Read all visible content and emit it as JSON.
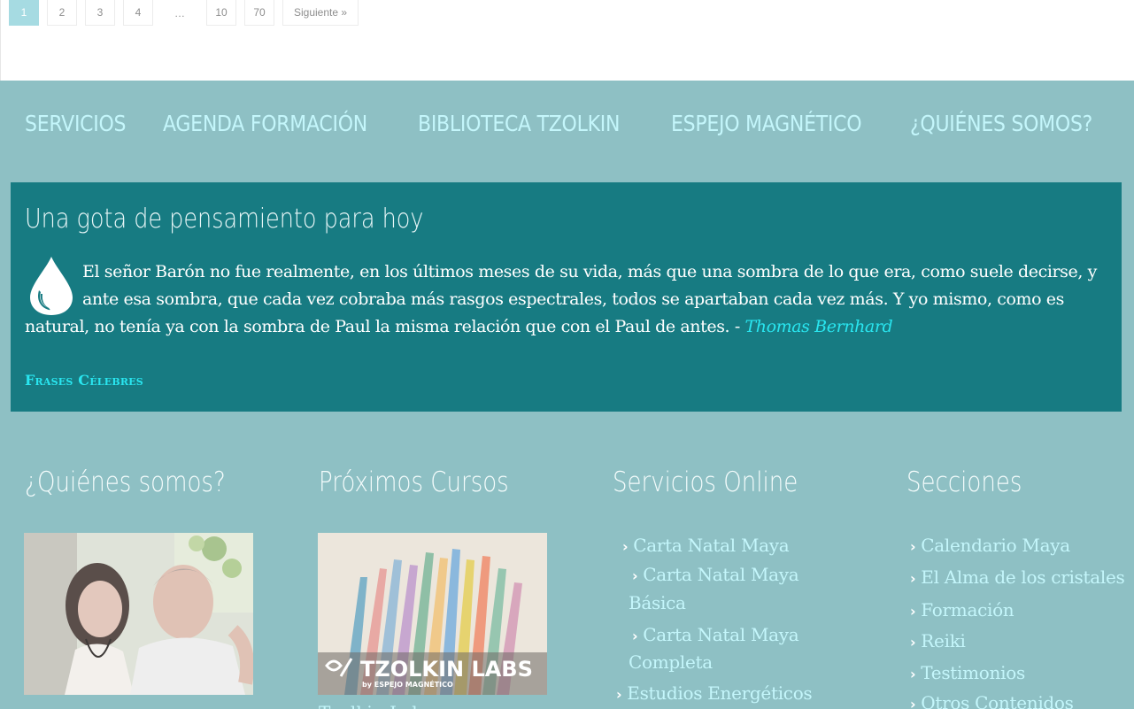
{
  "pagination": {
    "pages": [
      "1",
      "2",
      "3",
      "4",
      "…",
      "10",
      "70"
    ],
    "active_index": 0,
    "next_label": "Siguiente »"
  },
  "nav": {
    "items": [
      "SERVICIOS",
      "AGENDA FORMACIÓN",
      "BIBLIOTECA TZOLKIN",
      "ESPEJO MAGNÉTICO",
      "¿QUIÉNES SOMOS?"
    ]
  },
  "quote_widget": {
    "title": "Una gota de pensamiento para hoy",
    "text": "El señor Barón no fue realmente, en los últimos meses de su vida, más que una sombra de lo que era, como suele decirse, y ante esa sombra, que cada vez cobraba más rasgos espectrales, todos se apartaban cada vez más. Y yo mismo, como es natural, no tenía ya con la sombra de Paul la misma relación que con el Paul de antes. -",
    "author": "Thomas Bernhard",
    "source_link": "Frases Célebres",
    "icon": "water-drop-icon"
  },
  "footer": {
    "about": {
      "title": "¿Quiénes somos?"
    },
    "courses": {
      "title": "Próximos Cursos",
      "banner_text": "TZOLKIN LABS",
      "banner_subtext": "by ESPEJO MAGNÉTICO",
      "link_partial": "Tzolkin Lab"
    },
    "online": {
      "title": "Servicios Online",
      "items": [
        "Carta Natal Maya",
        "Carta Natal Maya",
        "Básica",
        "Carta Natal Maya",
        "Completa",
        "Estudios Energéticos"
      ]
    },
    "sections": {
      "title": "Secciones",
      "items": [
        "Calendario Maya",
        "El Alma de los cristales",
        "Formación",
        "Reiki",
        "Testimonios",
        "Otros Contenidos"
      ]
    }
  },
  "colors": {
    "page_background": "#8ec0c4",
    "quote_box": "#177b82",
    "link": "#c4f6fb",
    "highlight": "#29e6f0",
    "pager_active": "#a6dbe2"
  }
}
